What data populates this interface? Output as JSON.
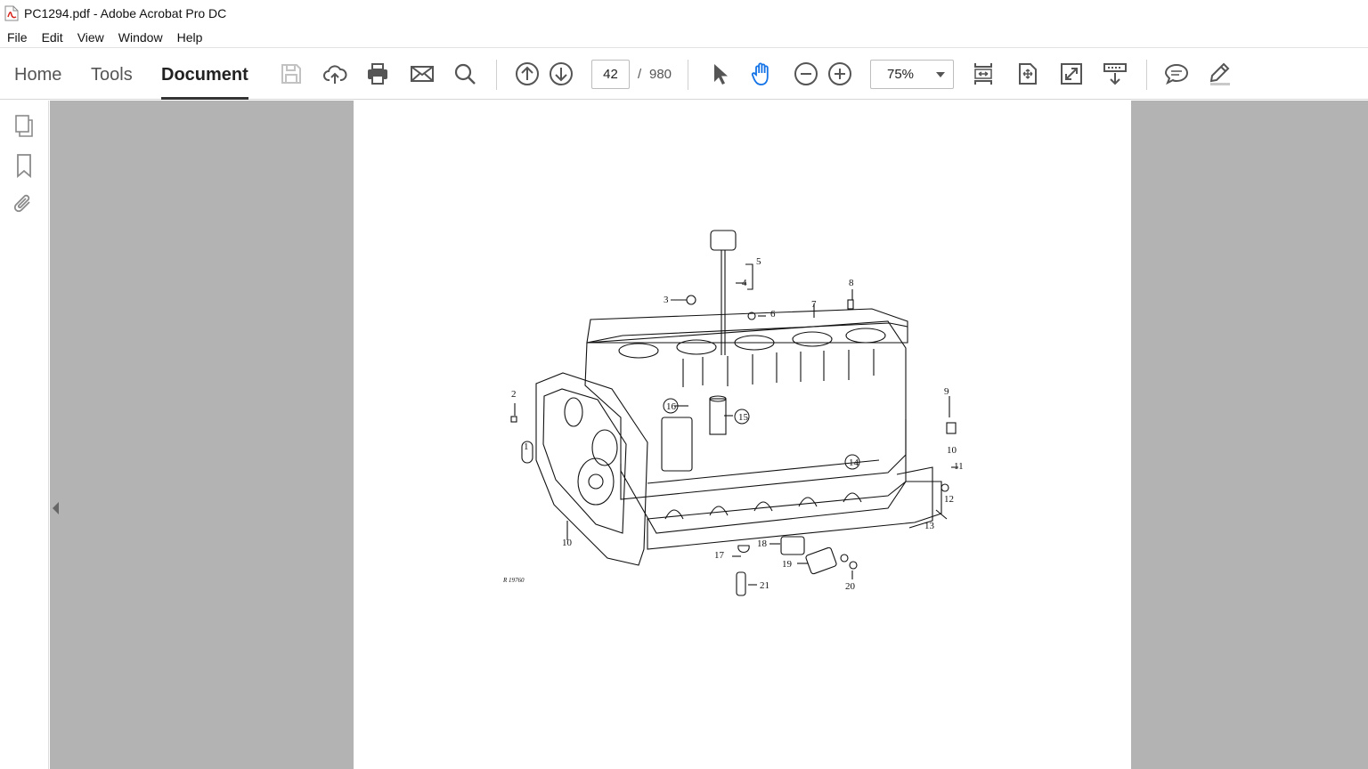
{
  "window": {
    "title": "PC1294.pdf - Adobe Acrobat Pro DC"
  },
  "menu": [
    "File",
    "Edit",
    "View",
    "Window",
    "Help"
  ],
  "nav_tabs": [
    {
      "label": "Home"
    },
    {
      "label": "Tools"
    },
    {
      "label": "Document"
    }
  ],
  "pager": {
    "current_page": "42",
    "separator": "/",
    "total_pages": "980"
  },
  "zoom": {
    "value": "75%"
  },
  "toolbar_icons": [
    "save-icon",
    "cloud-upload-icon",
    "print-icon",
    "email-icon",
    "search-icon",
    "previous-page-icon",
    "next-page-icon",
    "select-cursor-icon",
    "hand-tool-icon",
    "zoom-out-icon",
    "zoom-in-icon",
    "fit-page-icon",
    "rotate-icon",
    "full-screen-icon",
    "scroll-mode-icon",
    "comment-icon",
    "sign-icon"
  ],
  "rail_icons": [
    "page-thumbnails-icon",
    "bookmarks-icon",
    "attachments-icon"
  ],
  "drawing": {
    "figure_id": "R 19760",
    "callouts": [
      "1",
      "2",
      "3",
      "4",
      "5",
      "6",
      "7",
      "8",
      "9",
      "10",
      "10",
      "11",
      "12",
      "13",
      "14",
      "15",
      "16",
      "17",
      "18",
      "19",
      "20",
      "21"
    ]
  },
  "colors": {
    "doc_background": "#b3b3b3",
    "hand_tool_active": "#1473e6",
    "app_icon": "#d7251d"
  }
}
